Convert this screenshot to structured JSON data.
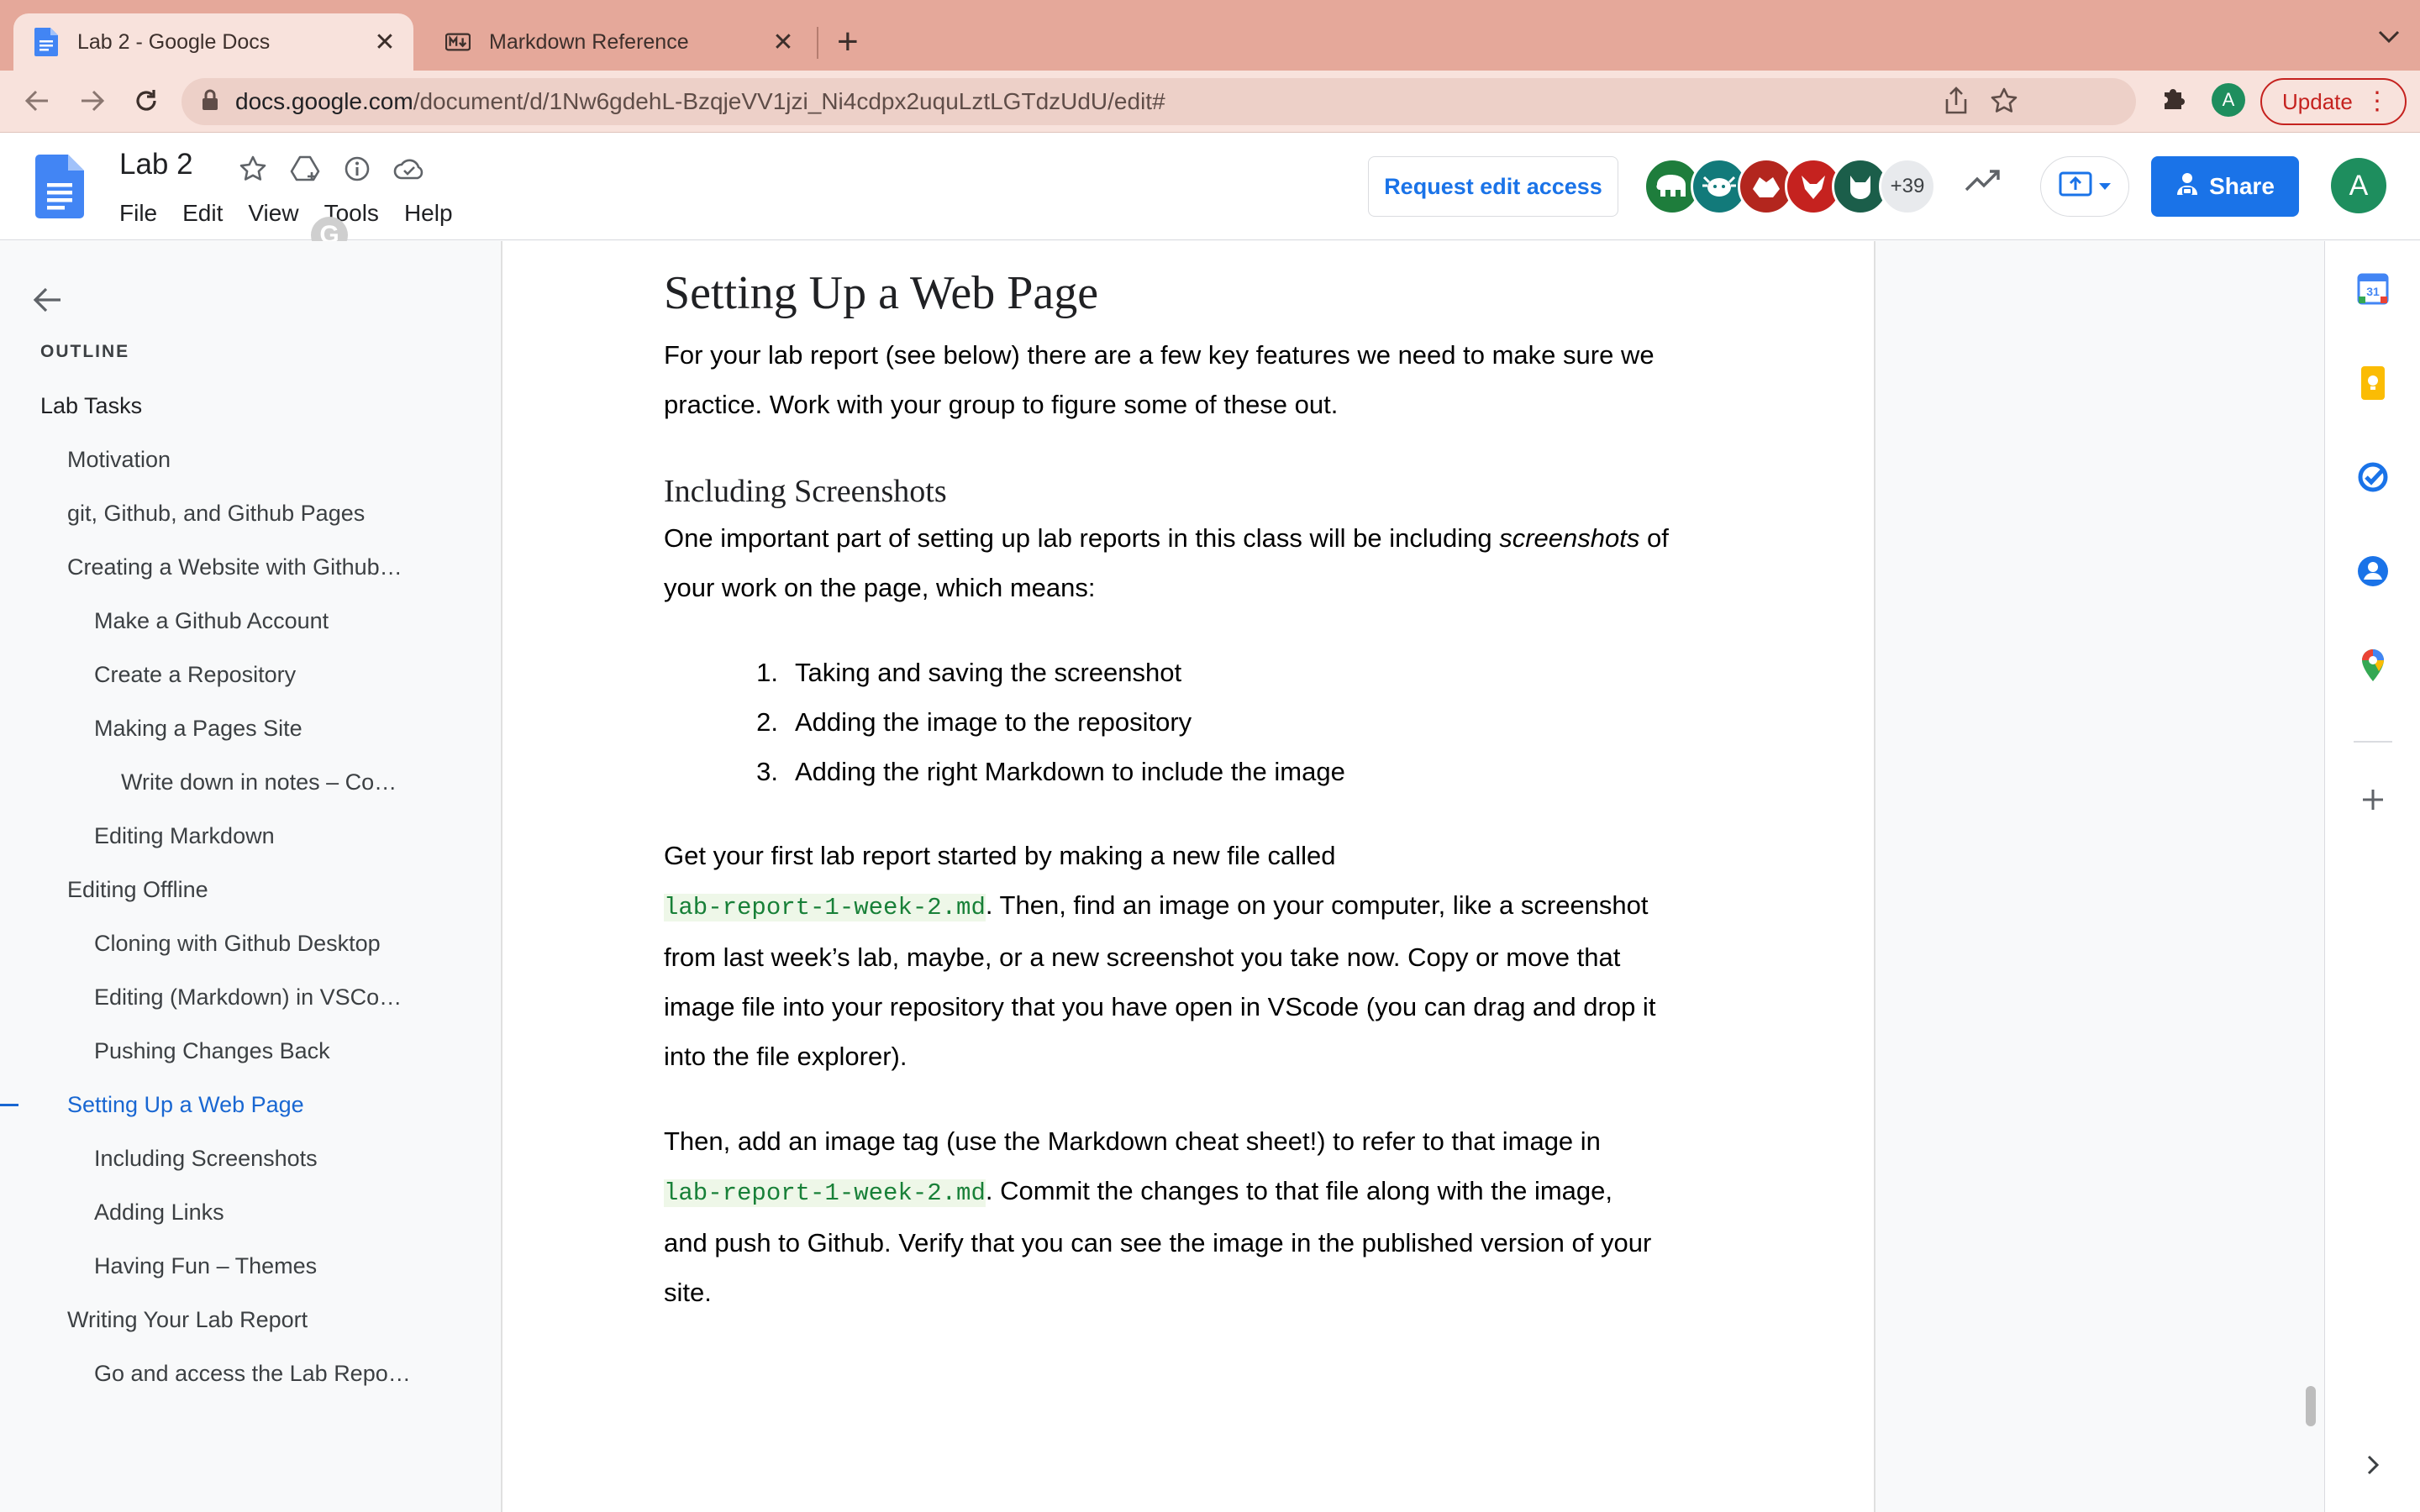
{
  "browser": {
    "tabs": [
      {
        "title": "Lab 2 - Google Docs",
        "active": true,
        "icon": "google-docs-icon"
      },
      {
        "title": "Markdown Reference",
        "active": false,
        "icon": "markdown-icon"
      }
    ],
    "close_glyph": "✕",
    "new_tab_glyph": "+",
    "url_host": "docs.google.com",
    "url_path": "/document/d/1Nw6gdehL-BzqjeVV1jzi_Ni4cdpx2uquLztLGTdzUdU/edit#",
    "profile_initial": "A",
    "update_label": "Update"
  },
  "docs": {
    "title": "Lab 2",
    "menu": [
      "File",
      "Edit",
      "View",
      "Tools",
      "Help"
    ],
    "grammarly_glyph": "G",
    "request_edit_label": "Request edit access",
    "more_viewers": "+39",
    "share_label": "Share",
    "account_initial": "A",
    "accent_color": "#1a73e8"
  },
  "outline": {
    "heading": "OUTLINE",
    "items": [
      {
        "label": "Lab Tasks",
        "level": 0
      },
      {
        "label": "Motivation",
        "level": 1
      },
      {
        "label": "git, Github, and Github Pages",
        "level": 1
      },
      {
        "label": "Creating a Website with Github…",
        "level": 1
      },
      {
        "label": "Make a Github Account",
        "level": 2
      },
      {
        "label": "Create a Repository",
        "level": 2
      },
      {
        "label": "Making a Pages Site",
        "level": 2
      },
      {
        "label": "Write down in notes – Co…",
        "level": 3
      },
      {
        "label": "Editing Markdown",
        "level": 2
      },
      {
        "label": "Editing Offline",
        "level": 1
      },
      {
        "label": "Cloning with Github Desktop",
        "level": 2
      },
      {
        "label": "Editing (Markdown) in VSCo…",
        "level": 2
      },
      {
        "label": "Pushing Changes Back",
        "level": 2
      },
      {
        "label": "Setting Up a Web Page",
        "level": 1,
        "active": true
      },
      {
        "label": "Including Screenshots",
        "level": 2
      },
      {
        "label": "Adding Links",
        "level": 2
      },
      {
        "label": "Having Fun – Themes",
        "level": 2
      },
      {
        "label": "Writing Your Lab Report",
        "level": 1
      },
      {
        "label": "Go and access the Lab Repo…",
        "level": 2
      }
    ]
  },
  "document": {
    "h1": "Setting Up a Web Page",
    "intro_line1": "For your lab report (see below) there are a few key features we need to make sure we",
    "intro_line2": "practice. Work with your group to figure some of these out.",
    "h2": "Including Screenshots",
    "ss_line1_a": "One important part of setting up lab reports in this class will be including ",
    "ss_line1_em": "screenshots",
    "ss_line1_b": " of",
    "ss_line2": "your work on the page, which means:",
    "steps": [
      {
        "num": "1.",
        "text": "Taking and saving the screenshot"
      },
      {
        "num": "2.",
        "text": "Adding the image to the repository"
      },
      {
        "num": "3.",
        "text": "Adding the right Markdown to include the image"
      }
    ],
    "p3_line1": "Get your first lab report started by making a new file called",
    "p3_code": "lab-report-1-week-2.md",
    "p3_line2_rest": ". Then, find an image on your computer, like a screenshot",
    "p3_line3": "from last week’s lab, maybe, or a new screenshot you take now. Copy or move that",
    "p3_line4": "image file into your repository that you have open in VScode (you can drag and drop it",
    "p3_line5": "into the file explorer).",
    "p4_line1": "Then, add an image tag (use the Markdown cheat sheet!) to refer to that image in",
    "p4_code": "lab-report-1-week-2.md",
    "p4_line2_rest": ". Commit the changes to that file along with the image,",
    "p4_line3": "and push to Github. Verify that you can see the image in the published version of your",
    "p4_line4": "site."
  },
  "side_panel": {
    "icons": [
      "calendar-icon",
      "keep-icon",
      "tasks-icon",
      "contacts-icon",
      "maps-icon",
      "add-icon",
      "expand-icon"
    ]
  }
}
